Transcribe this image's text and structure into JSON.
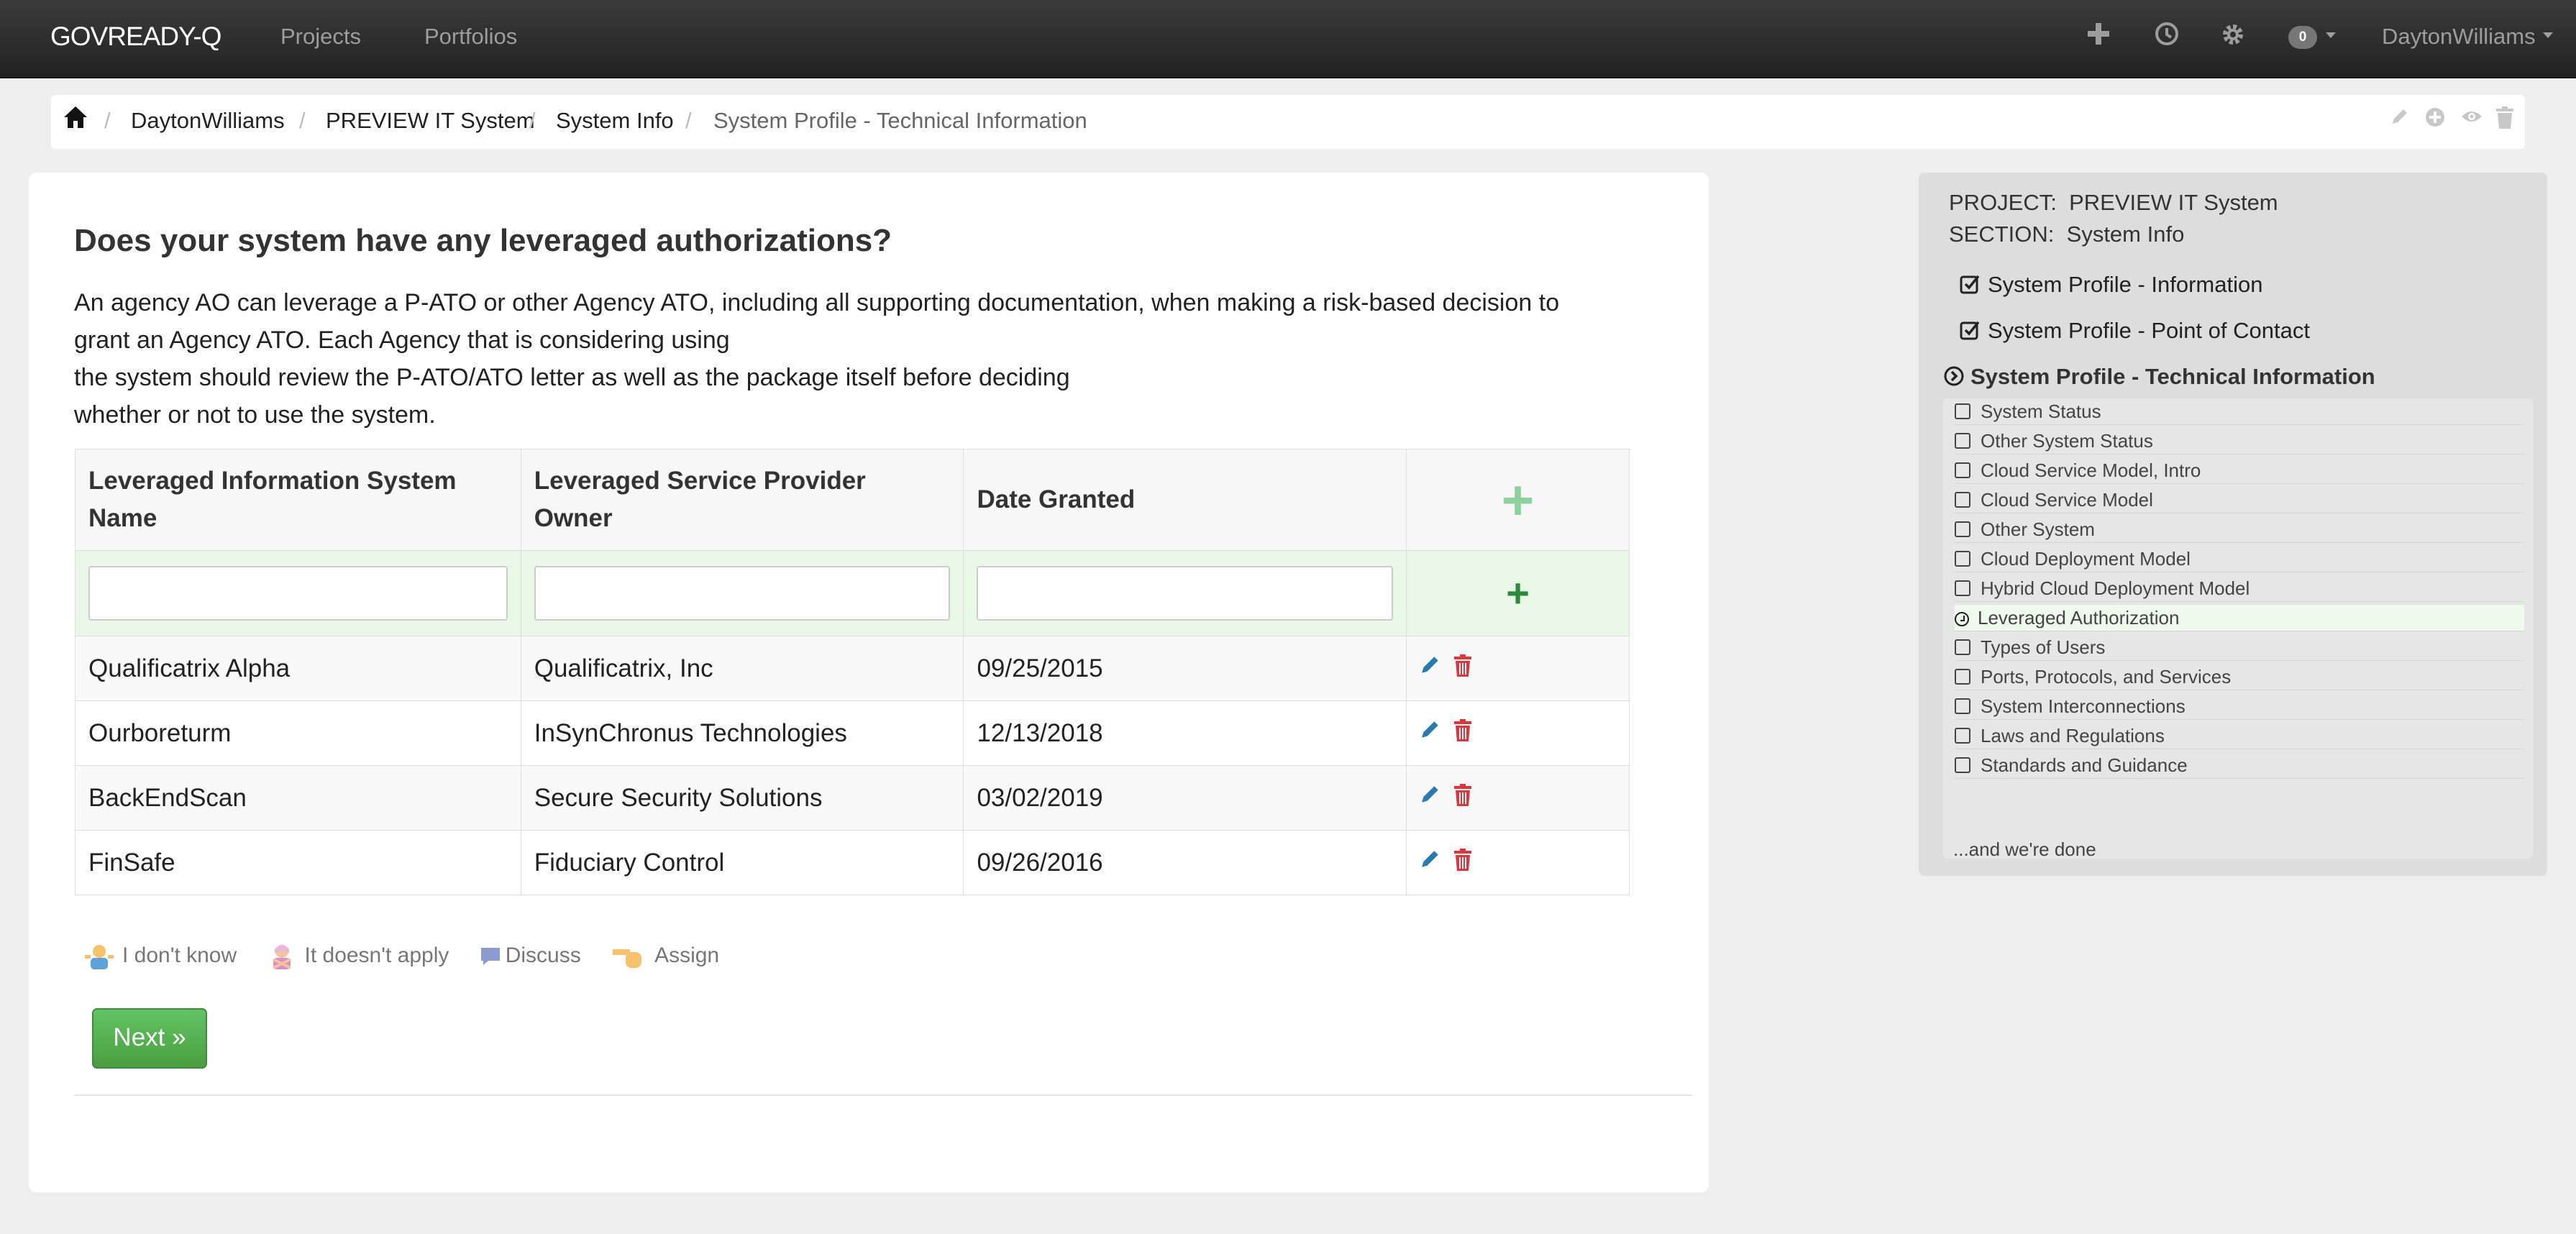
{
  "navbar": {
    "brand": "GOVREADY-Q",
    "links": [
      "Projects",
      "Portfolios"
    ],
    "notification_count": "0",
    "user": "DaytonWilliams"
  },
  "breadcrumb": {
    "items": [
      "DaytonWilliams",
      "PREVIEW IT System",
      "System Info"
    ],
    "active": "System Profile - Technical Information"
  },
  "question": {
    "title": "Does your system have any leveraged authorizations?",
    "prompt_lines": [
      "An agency AO can leverage a P-ATO or other Agency ATO, including all supporting documentation, when making a risk-based decision to",
      "grant an Agency ATO. Each Agency that is considering using",
      "the system should review the P-ATO/ATO letter as well as the package itself before deciding",
      "whether or not to use the system."
    ]
  },
  "table": {
    "headers": [
      "Leveraged Information System Name",
      "Leveraged Service Provider Owner",
      "Date Granted"
    ],
    "rows": [
      {
        "name": "Qualificatrix Alpha",
        "owner": "Qualificatrix, Inc",
        "date": "09/25/2015"
      },
      {
        "name": "Ourboreturm",
        "owner": "InSynChronus Technologies",
        "date": "12/13/2018"
      },
      {
        "name": "BackEndScan",
        "owner": "Secure Security Solutions",
        "date": "03/02/2019"
      },
      {
        "name": "FinSafe",
        "owner": "Fiduciary Control",
        "date": "09/26/2016"
      }
    ]
  },
  "help": {
    "dont_know": "I don't know",
    "doesnt_apply": "It doesn't apply",
    "discuss": "Discuss",
    "assign": "Assign"
  },
  "next_label": "Next »",
  "sidebar": {
    "project_label": "PROJECT:",
    "project": "PREVIEW IT System",
    "section_label": "SECTION:",
    "section": "System Info",
    "completed": [
      "System Profile - Information",
      "System Profile - Point of Contact"
    ],
    "current": "System Profile - Technical Information",
    "questions": [
      "System Status",
      "Other System Status",
      "Cloud Service Model, Intro",
      "Cloud Service Model",
      "Other System",
      "Cloud Deployment Model",
      "Hybrid Cloud Deployment Model",
      "Leveraged Authorization",
      "Types of Users",
      "Ports, Protocols, and Services",
      "System Interconnections",
      "Laws and Regulations",
      "Standards and Guidance"
    ],
    "active_question": "Leveraged Authorization",
    "done_text": "...and we're done"
  },
  "colors": {
    "navbar": "#222222",
    "success_green": "#4a9e40",
    "edit_blue": "#2a7ab0",
    "delete_red": "#d9363e",
    "entry_row_bg": "#e9f8e6"
  }
}
